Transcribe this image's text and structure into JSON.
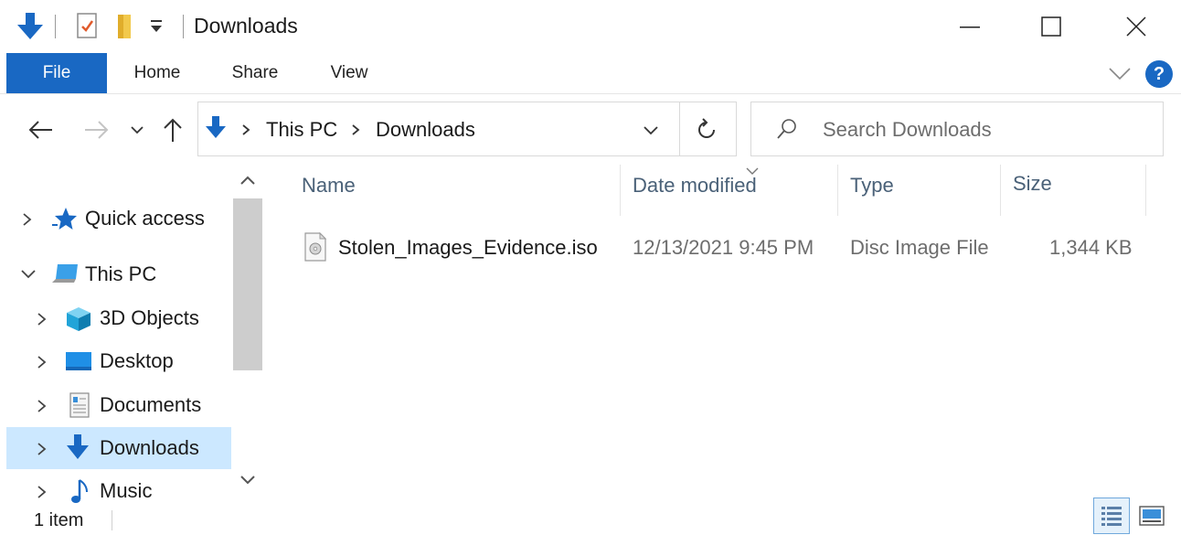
{
  "window": {
    "title": "Downloads"
  },
  "ribbon": {
    "tabs": [
      "File",
      "Home",
      "Share",
      "View"
    ],
    "help_label": "?"
  },
  "address": {
    "segments": [
      "This PC",
      "Downloads"
    ]
  },
  "search": {
    "placeholder": "Search Downloads"
  },
  "nav": {
    "items": [
      {
        "label": "Quick access",
        "icon": "star-icon"
      },
      {
        "label": "This PC",
        "icon": "computer-icon"
      },
      {
        "label": "3D Objects",
        "icon": "3d-objects-icon"
      },
      {
        "label": "Desktop",
        "icon": "desktop-icon"
      },
      {
        "label": "Documents",
        "icon": "documents-icon"
      },
      {
        "label": "Downloads",
        "icon": "download-arrow-icon",
        "selected": true
      },
      {
        "label": "Music",
        "icon": "music-note-icon"
      }
    ]
  },
  "columns": {
    "name": "Name",
    "date": "Date modified",
    "type": "Type",
    "size": "Size"
  },
  "files": [
    {
      "name": "Stolen_Images_Evidence.iso",
      "date": "12/13/2021 9:45 PM",
      "type": "Disc Image File",
      "size": "1,344 KB",
      "icon": "disc-image-icon"
    }
  ],
  "status": {
    "item_count": "1 item"
  },
  "colors": {
    "accent": "#1968c3",
    "selected_bg": "#cce8ff",
    "header_text": "#4a6178"
  }
}
